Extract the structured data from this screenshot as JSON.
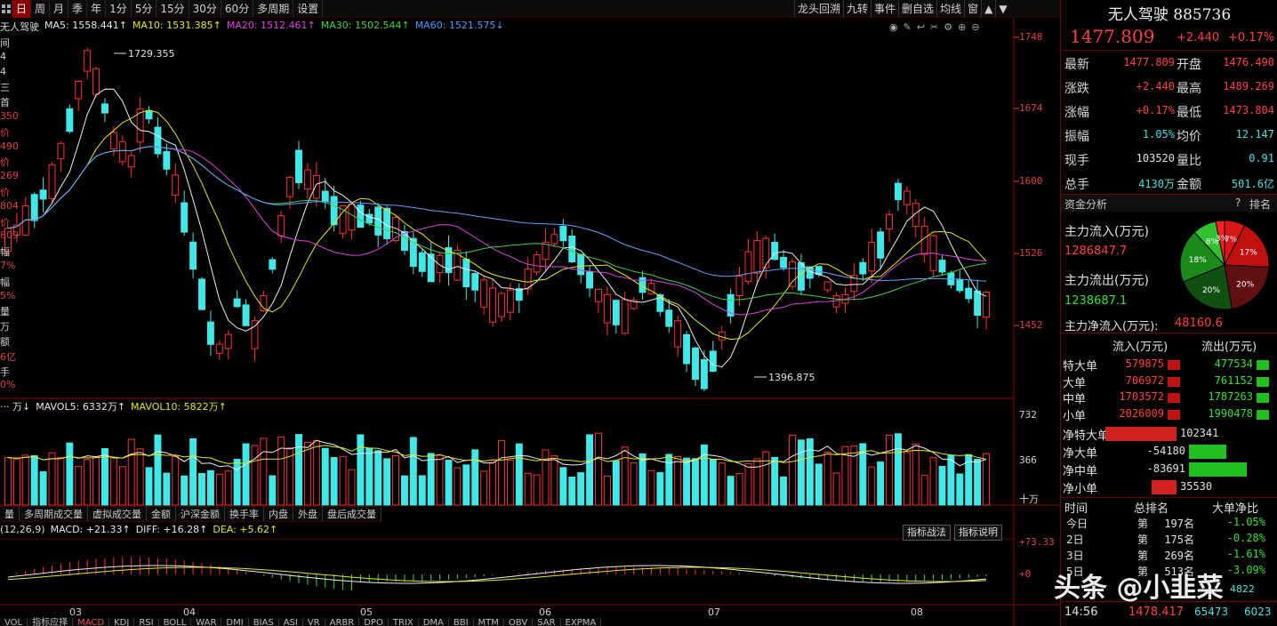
{
  "toolbar": {
    "items": [
      "日",
      "周",
      "月",
      "季",
      "年",
      "1分",
      "5分",
      "15分",
      "30分",
      "60分",
      "多周期",
      "设置"
    ],
    "active_index": 0,
    "first_icon": "grid-icon",
    "right_items": [
      "龙头回溯",
      "九转",
      "事件",
      "删自选",
      "均线",
      "窗"
    ]
  },
  "ma_legend": {
    "name": "无人驾驶",
    "ma5": "MA5: 1558.441↑",
    "ma10": "MA10: 1531.385↑",
    "ma20": "MA20: 1512.461↑",
    "ma30": "MA30: 1502.544↑",
    "ma60": "MA60: 1521.575↓"
  },
  "vol_legend": {
    "prefix": "··· 万↓",
    "mavol5": "MAVOL5: 6332万↑",
    "mavol10": "MAVOL10: 5822万↑"
  },
  "macd_legend": {
    "prefix": "(12,26,9)",
    "macd": "MACD: +21.33↑",
    "diff": "DIFF: +16.28↑",
    "dea": "DEA: +5.62↑"
  },
  "price_axis": [
    "1748",
    "1674",
    "1600",
    "1526",
    "1452"
  ],
  "vol_axis": [
    "732",
    "366",
    "十万"
  ],
  "macd_axis": [
    "+73.33",
    "+0"
  ],
  "annotations": {
    "high": "1729.355",
    "low": "1396.875"
  },
  "months": [
    "03",
    "04",
    "05",
    "06",
    "07",
    "08"
  ],
  "left_strip": [
    "间",
    "4",
    "4",
    "三",
    "首",
    "350",
    "价",
    "490",
    "价",
    "269",
    "价",
    "804",
    "价",
    "809",
    "幅",
    "7%",
    "幅",
    "5%",
    "量",
    "万",
    "额",
    "6亿",
    "手",
    "0%"
  ],
  "sub_tabs": [
    "量",
    "多周期成交量",
    "虚拟成交量",
    "金额",
    "沪深金额",
    "换手率",
    "内盘",
    "外盘",
    "盘后成交量"
  ],
  "macd_buttons": [
    "指标战法",
    "指标说明"
  ],
  "indicator_tabs": [
    "VOL",
    "指标应择",
    "MACD",
    "KDJ",
    "RSI",
    "BOLL",
    "WAR",
    "DMI",
    "BIAS",
    "ASI",
    "VR",
    "ARBR",
    "DPO",
    "TRIX",
    "DMA",
    "BBI",
    "MTM",
    "OBV",
    "SAR",
    "EXPMA"
  ],
  "panel": {
    "title": "无人驾驶 885736",
    "price": "1477.809",
    "change": "+2.440",
    "change_pct": "+0.17%",
    "stats": [
      {
        "l1": "最新",
        "v1": "1477.809",
        "c1": "red",
        "l2": "开盘",
        "v2": "1476.490",
        "c2": "red"
      },
      {
        "l1": "涨跌",
        "v1": "+2.440",
        "c1": "red",
        "l2": "最高",
        "v2": "1489.269",
        "c2": "red"
      },
      {
        "l1": "涨幅",
        "v1": "+0.17%",
        "c1": "red",
        "l2": "最低",
        "v2": "1473.804",
        "c2": "red"
      },
      {
        "l1": "振幅",
        "v1": "1.05%",
        "c1": "cyan",
        "l2": "均价",
        "v2": "12.147",
        "c2": "cyan"
      },
      {
        "l1": "现手",
        "v1": "103520",
        "c1": "white",
        "l2": "量比",
        "v2": "0.91",
        "c2": "cyan"
      },
      {
        "l1": "总手",
        "v1": "4130万",
        "c1": "cyan",
        "l2": "金额",
        "v2": "501.6亿",
        "c2": "cyan"
      }
    ],
    "fund_title": "资金分析",
    "fund_q": "?",
    "fund_rank": "排名",
    "main_in_label": "主力流入(万元)",
    "main_in": "1286847.7",
    "main_out_label": "主力流出(万元)",
    "main_out": "1238687.1",
    "net_label": "主力净流入(万元):",
    "net_value": "48160.6",
    "pie": {
      "slices": [
        {
          "label": "7%",
          "value": 7,
          "color": "#d81818"
        },
        {
          "label": "17%",
          "value": 17,
          "color": "#c01010"
        },
        {
          "label": "20%",
          "value": 20,
          "color": "#601010"
        },
        {
          "label": "20%",
          "value": 20,
          "color": "#105010"
        },
        {
          "label": "18%",
          "value": 18,
          "color": "#1a8a1a"
        },
        {
          "label": "8%",
          "value": 8,
          "color": "#30c030"
        },
        {
          "label": "3%",
          "value": 3,
          "color": "#ff2020"
        }
      ]
    },
    "flow_head": {
      "in": "流入(万元)",
      "out": "流出(万元)"
    },
    "flows": [
      {
        "name": "特大单",
        "in": "579875",
        "out": "477534"
      },
      {
        "name": "大单",
        "in": "706972",
        "out": "761152"
      },
      {
        "name": "中单",
        "in": "1703572",
        "out": "1787263"
      },
      {
        "name": "小单",
        "in": "2026009",
        "out": "1990478"
      }
    ],
    "nets": [
      {
        "name": "净特大单",
        "value": "102341",
        "v": 102341
      },
      {
        "name": "净大单",
        "value": "-54180",
        "v": -54180
      },
      {
        "name": "净中单",
        "value": "-83691",
        "v": -83691
      },
      {
        "name": "净小单",
        "value": "35530",
        "v": 35530
      }
    ],
    "rank_head": {
      "time": "时间",
      "rank": "总排名",
      "net": "大单净比"
    },
    "ranks": [
      {
        "t": "今日",
        "p": "第",
        "r": "197名",
        "n": "-1.05%"
      },
      {
        "t": "2日",
        "p": "第",
        "r": "175名",
        "n": "-0.28%"
      },
      {
        "t": "3日",
        "p": "第",
        "r": "269名",
        "n": "-1.61%"
      },
      {
        "t": "5日",
        "p": "第",
        "r": "513名",
        "n": "-3.09%"
      }
    ],
    "tick": {
      "time": "14:56",
      "price": "1478.417",
      "vol": "65473",
      "side": "6023"
    },
    "extra": "4822",
    "watermark": "头条 @小韭菜"
  }
}
